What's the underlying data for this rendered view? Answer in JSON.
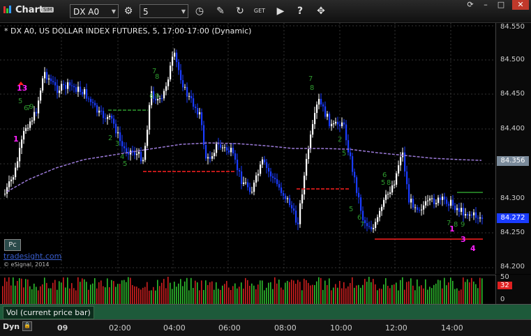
{
  "toolbar": {
    "title": "Chart",
    "sim": "SIM",
    "symbol": "DX A0",
    "interval": "5",
    "gear": "gear-icon",
    "refresh": "clock-icon",
    "draw": "pencil-icon",
    "cycle": "cycle-icon",
    "get": "GET",
    "play": "play-icon",
    "help": "?",
    "tools": "tools-icon",
    "reload": "reload-icon",
    "min": "–",
    "max": "□",
    "close": "✕"
  },
  "chart": {
    "title": "* DX A0, US DOLLAR INDEX FUTURES, 5, 17:00-17:00 (Dynamic)",
    "price_labels": [
      "84.550",
      "84.500",
      "84.450",
      "84.400",
      "84.350",
      "84.300",
      "84.250",
      "84.200"
    ],
    "last_ma": "84.356",
    "last_price": "84.272",
    "pc_label": "Pc",
    "brand": "tradesight.com",
    "copyright": "© eSignal, 2014",
    "annotations_magenta": [
      "13",
      "1",
      "1",
      "3",
      "4"
    ],
    "colors": {
      "up": "#ffffff",
      "down": "#1a3cff",
      "ma": "#9b7ad8",
      "green": "#2e9a2e",
      "red": "#ff2020",
      "magenta": "#ff20ff",
      "ma_tag": "#7a8a9a",
      "price_tag": "#1a3cff"
    }
  },
  "volume": {
    "label": "Vol (current price bar)",
    "axis": [
      "50",
      "32",
      "0"
    ]
  },
  "time_axis": {
    "dyn": "Dyn",
    "labels": [
      "09",
      "02:00",
      "04:00",
      "06:00",
      "08:00",
      "10:00",
      "12:00",
      "14:00"
    ]
  }
}
